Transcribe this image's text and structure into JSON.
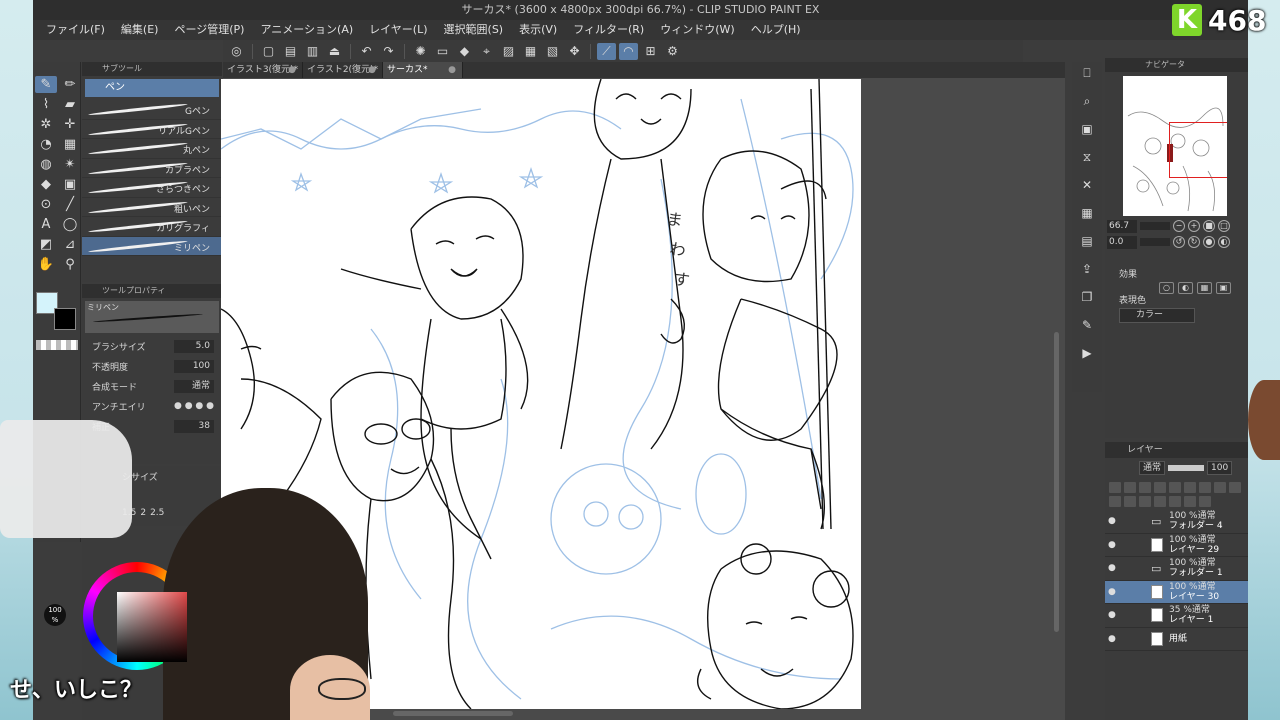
{
  "titlebar": {
    "title": "サーカス* (3600 x 4800px 300dpi 66.7%)  - CLIP STUDIO PAINT EX"
  },
  "menu": [
    "ファイル(F)",
    "編集(E)",
    "ページ管理(P)",
    "アニメーション(A)",
    "レイヤー(L)",
    "選択範囲(S)",
    "表示(V)",
    "フィルター(R)",
    "ウィンドウ(W)",
    "ヘルプ(H)"
  ],
  "tabs": [
    {
      "label": "イラスト3(復元)*"
    },
    {
      "label": "イラスト2(復元)*"
    },
    {
      "label": "サーカス*"
    }
  ],
  "subtool": {
    "header": "サブツール",
    "group": "ペン",
    "brushes": [
      "Gペン",
      "リアルGペン",
      "丸ペン",
      "カブラペン",
      "ざらつきペン",
      "粗いペン",
      "カリグラフィ",
      "ミリペン"
    ]
  },
  "toolprop": {
    "header": "ツールプロパティ",
    "preview_label": "ミリペン",
    "rows": [
      {
        "label": "ブラシサイズ",
        "value": "5.0"
      },
      {
        "label": "不透明度",
        "value": "100"
      },
      {
        "label": "合成モード",
        "value": "通常"
      },
      {
        "label": "アンチエイリ",
        "value": ""
      },
      {
        "label": "補正",
        "value": "38"
      }
    ]
  },
  "brushsize": {
    "header": "シサイズ",
    "values": [
      "1.5",
      "2",
      "2.5"
    ]
  },
  "opacity_label": "100 %",
  "navigator": {
    "header": "ナビゲータ",
    "zoom": "66.7",
    "rotation": "0.0"
  },
  "layerprop": {
    "effect_label": "効果",
    "expression_label": "表現色",
    "expression_value": "カラー"
  },
  "layers": {
    "header": "レイヤー",
    "blend_mode": "通常",
    "opacity": "100",
    "items": [
      {
        "mode": "100 %通常",
        "name": "フォルダー 4",
        "type": "folder"
      },
      {
        "mode": "100 %通常",
        "name": "レイヤー 29",
        "type": "layer"
      },
      {
        "mode": "100 %通常",
        "name": "フォルダー 1",
        "type": "folder"
      },
      {
        "mode": "100 %通常",
        "name": "レイヤー 30",
        "type": "layer",
        "selected": true
      },
      {
        "mode": "35 %通常",
        "name": "レイヤー 1",
        "type": "layer"
      },
      {
        "mode": "",
        "name": "用紙",
        "type": "paper"
      }
    ]
  },
  "overlay": {
    "badge_letter": "K",
    "badge_count": "468",
    "subtitle": "せ、いしこ？"
  },
  "colors": {
    "accent": "#5b7ea8",
    "main_color": "#d4f3fb",
    "sub_color": "#000000"
  }
}
